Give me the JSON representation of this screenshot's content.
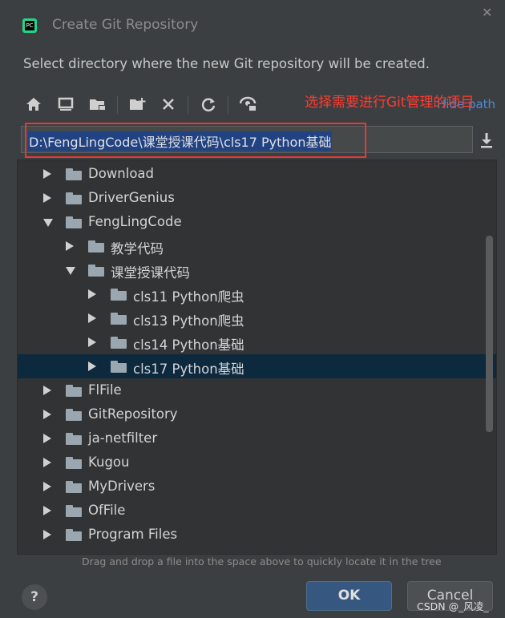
{
  "dialog": {
    "title": "Create Git Repository",
    "app_icon_text": "PC",
    "subtitle": "Select directory where the new Git repository will be created.",
    "annotation": "选择需要进行Git管理的项目",
    "hide_path": "Hide path",
    "path_value": "D:\\FengLingCode\\课堂授课代码\\cls17 Python基础",
    "hint": "Drag and drop a file into the space above to quickly locate it in the tree",
    "help_label": "?",
    "ok_label": "OK",
    "cancel_label": "Cancel",
    "watermark": "CSDN @_风凌_"
  },
  "toolbar": {
    "icons": [
      "home-icon",
      "desktop-icon",
      "project-folder-icon",
      "new-folder-icon",
      "delete-icon",
      "refresh-icon",
      "show-hidden-icon"
    ]
  },
  "tree": {
    "rows": [
      {
        "label": "Download",
        "level": 0,
        "state": "collapsed"
      },
      {
        "label": "DriverGenius",
        "level": 0,
        "state": "collapsed"
      },
      {
        "label": "FengLingCode",
        "level": 0,
        "state": "expanded"
      },
      {
        "label": "教学代码",
        "level": 1,
        "state": "collapsed"
      },
      {
        "label": "课堂授课代码",
        "level": 1,
        "state": "expanded"
      },
      {
        "label": "cls11 Python爬虫",
        "level": 2,
        "state": "collapsed"
      },
      {
        "label": "cls13 Python爬虫",
        "level": 2,
        "state": "collapsed"
      },
      {
        "label": "cls14 Python基础",
        "level": 2,
        "state": "collapsed"
      },
      {
        "label": "cls17 Python基础",
        "level": 2,
        "state": "collapsed",
        "selected": true
      },
      {
        "label": "FlFile",
        "level": 0,
        "state": "collapsed"
      },
      {
        "label": "GitRepository",
        "level": 0,
        "state": "collapsed"
      },
      {
        "label": "ja-netfilter",
        "level": 0,
        "state": "collapsed"
      },
      {
        "label": "Kugou",
        "level": 0,
        "state": "collapsed"
      },
      {
        "label": "MyDrivers",
        "level": 0,
        "state": "collapsed"
      },
      {
        "label": "OfFile",
        "level": 0,
        "state": "collapsed"
      },
      {
        "label": "Program Files",
        "level": 0,
        "state": "collapsed"
      }
    ]
  },
  "colors": {
    "background": "#3c3f41",
    "selection": "#0d293e",
    "annotation": "#ff3b30",
    "path_highlight": "#214283",
    "ok_button": "#365880"
  }
}
